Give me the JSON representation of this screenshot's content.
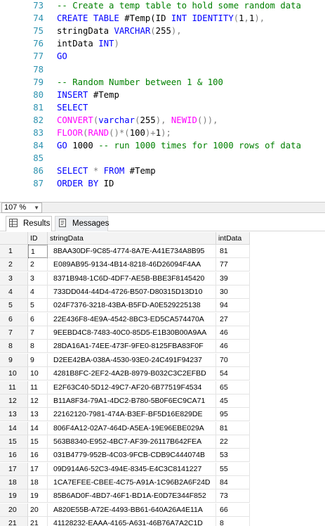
{
  "editor": {
    "lines": [
      {
        "num": "73",
        "tokens": [
          {
            "t": "-- Create a temp table to hold some random data",
            "c": "cm"
          }
        ]
      },
      {
        "num": "74",
        "tokens": [
          {
            "t": "CREATE TABLE ",
            "c": "kw"
          },
          {
            "t": "#Temp(",
            "c": "pl"
          },
          {
            "t": "ID ",
            "c": "pl"
          },
          {
            "t": "INT IDENTITY",
            "c": "kw"
          },
          {
            "t": "(",
            "c": "gr"
          },
          {
            "t": "1",
            "c": "pl"
          },
          {
            "t": ",",
            "c": "gr"
          },
          {
            "t": "1",
            "c": "pl"
          },
          {
            "t": "),",
            "c": "gr"
          }
        ]
      },
      {
        "num": "75",
        "tokens": [
          {
            "t": "stringData ",
            "c": "pl"
          },
          {
            "t": "VARCHAR",
            "c": "kw"
          },
          {
            "t": "(",
            "c": "gr"
          },
          {
            "t": "255",
            "c": "pl"
          },
          {
            "t": "),",
            "c": "gr"
          }
        ]
      },
      {
        "num": "76",
        "tokens": [
          {
            "t": "intData ",
            "c": "pl"
          },
          {
            "t": "INT",
            "c": "kw"
          },
          {
            "t": ")",
            "c": "gr"
          }
        ]
      },
      {
        "num": "77",
        "tokens": [
          {
            "t": "GO",
            "c": "kw"
          }
        ]
      },
      {
        "num": "78",
        "tokens": []
      },
      {
        "num": "79",
        "tokens": [
          {
            "t": "-- Random Number between 1 & 100",
            "c": "cm"
          }
        ]
      },
      {
        "num": "80",
        "tokens": [
          {
            "t": "INSERT ",
            "c": "kw"
          },
          {
            "t": "#Temp",
            "c": "pl"
          }
        ]
      },
      {
        "num": "81",
        "tokens": [
          {
            "t": "SELECT",
            "c": "kw"
          }
        ]
      },
      {
        "num": "82",
        "tokens": [
          {
            "t": "CONVERT",
            "c": "fn"
          },
          {
            "t": "(",
            "c": "gr"
          },
          {
            "t": "varchar",
            "c": "kw"
          },
          {
            "t": "(",
            "c": "gr"
          },
          {
            "t": "255",
            "c": "pl"
          },
          {
            "t": "), ",
            "c": "gr"
          },
          {
            "t": "NEWID",
            "c": "fn"
          },
          {
            "t": "()),",
            "c": "gr"
          }
        ]
      },
      {
        "num": "83",
        "tokens": [
          {
            "t": "FLOOR",
            "c": "fn"
          },
          {
            "t": "(",
            "c": "gr"
          },
          {
            "t": "RAND",
            "c": "fn"
          },
          {
            "t": "()*(",
            "c": "gr"
          },
          {
            "t": "100",
            "c": "pl"
          },
          {
            "t": ")+",
            "c": "gr"
          },
          {
            "t": "1",
            "c": "pl"
          },
          {
            "t": ");",
            "c": "gr"
          }
        ]
      },
      {
        "num": "84",
        "tokens": [
          {
            "t": "GO ",
            "c": "kw"
          },
          {
            "t": "1000 ",
            "c": "pl"
          },
          {
            "t": "-- run 1000 times for 1000 rows of data",
            "c": "cm"
          }
        ]
      },
      {
        "num": "85",
        "tokens": []
      },
      {
        "num": "86",
        "tokens": [
          {
            "t": "SELECT ",
            "c": "kw"
          },
          {
            "t": "* ",
            "c": "gr"
          },
          {
            "t": "FROM ",
            "c": "kw"
          },
          {
            "t": "#Temp",
            "c": "pl"
          }
        ]
      },
      {
        "num": "87",
        "tokens": [
          {
            "t": "ORDER BY ",
            "c": "kw"
          },
          {
            "t": "ID",
            "c": "pl"
          }
        ]
      }
    ]
  },
  "zoom": {
    "value": "107 %"
  },
  "results_tabs": [
    {
      "label": "Results",
      "icon": "grid-icon",
      "active": true
    },
    {
      "label": "Messages",
      "icon": "messages-icon",
      "active": false
    }
  ],
  "grid": {
    "columns": [
      "ID",
      "stringData",
      "intData"
    ],
    "rows": [
      [
        "1",
        "1",
        "8BAA30DF-9C85-4774-8A7E-A41E734A8B95",
        "81"
      ],
      [
        "2",
        "2",
        "E089AB95-9134-4B14-8218-46D26094F4AA",
        "77"
      ],
      [
        "3",
        "3",
        "8371B948-1C6D-4DF7-AE5B-BBE3F8145420",
        "39"
      ],
      [
        "4",
        "4",
        "733DD044-44D4-4726-B507-D80315D13D10",
        "30"
      ],
      [
        "5",
        "5",
        "024F7376-3218-43BA-B5FD-A0E529225138",
        "94"
      ],
      [
        "6",
        "6",
        "22E436F8-4E9A-4542-8BC3-ED5CA574470A",
        "27"
      ],
      [
        "7",
        "7",
        "9EEBD4C8-7483-40C0-85D5-E1B30B00A9AA",
        "46"
      ],
      [
        "8",
        "8",
        "28DA16A1-74EE-473F-9FE0-8125FBA83F0F",
        "46"
      ],
      [
        "9",
        "9",
        "D2EE42BA-038A-4530-93E0-24C491F94237",
        "70"
      ],
      [
        "10",
        "10",
        "4281B8FC-2EF2-4A2B-8979-B032C3C2EFBD",
        "54"
      ],
      [
        "11",
        "11",
        "E2F63C40-5D12-49C7-AF20-6B77519F4534",
        "65"
      ],
      [
        "12",
        "12",
        "B11A8F34-79A1-4DC2-B780-5B0F6EC9CA71",
        "45"
      ],
      [
        "13",
        "13",
        "22162120-7981-474A-B3EF-BF5D16E829DE",
        "95"
      ],
      [
        "14",
        "14",
        "806F4A12-02A7-464D-A5EA-19E96EBE029A",
        "81"
      ],
      [
        "15",
        "15",
        "563B8340-E952-4BC7-AF39-26117B642FEA",
        "22"
      ],
      [
        "16",
        "16",
        "031B4779-952B-4C03-9FCB-CDB9C444074B",
        "53"
      ],
      [
        "17",
        "17",
        "09D914A6-52C3-494E-8345-E4C3C8141227",
        "55"
      ],
      [
        "18",
        "18",
        "1CA7EFEE-CBEE-4C75-A91A-1C96B2A6F24D",
        "84"
      ],
      [
        "19",
        "19",
        "85B6AD0F-4BD7-46F1-BD1A-E0D7E344F852",
        "73"
      ],
      [
        "20",
        "20",
        "A820E55B-A72E-4493-BB61-640A26A4E11A",
        "66"
      ],
      [
        "21",
        "21",
        "41128232-EAAA-4165-A631-46B76A7A2C1D",
        "8"
      ]
    ]
  },
  "colors": {
    "line_number": "#2b91af",
    "gutter_bar": "#ffffff",
    "keyword": "#0000ff",
    "function": "#ff00ff",
    "comment": "#008000",
    "operator": "#808080"
  }
}
